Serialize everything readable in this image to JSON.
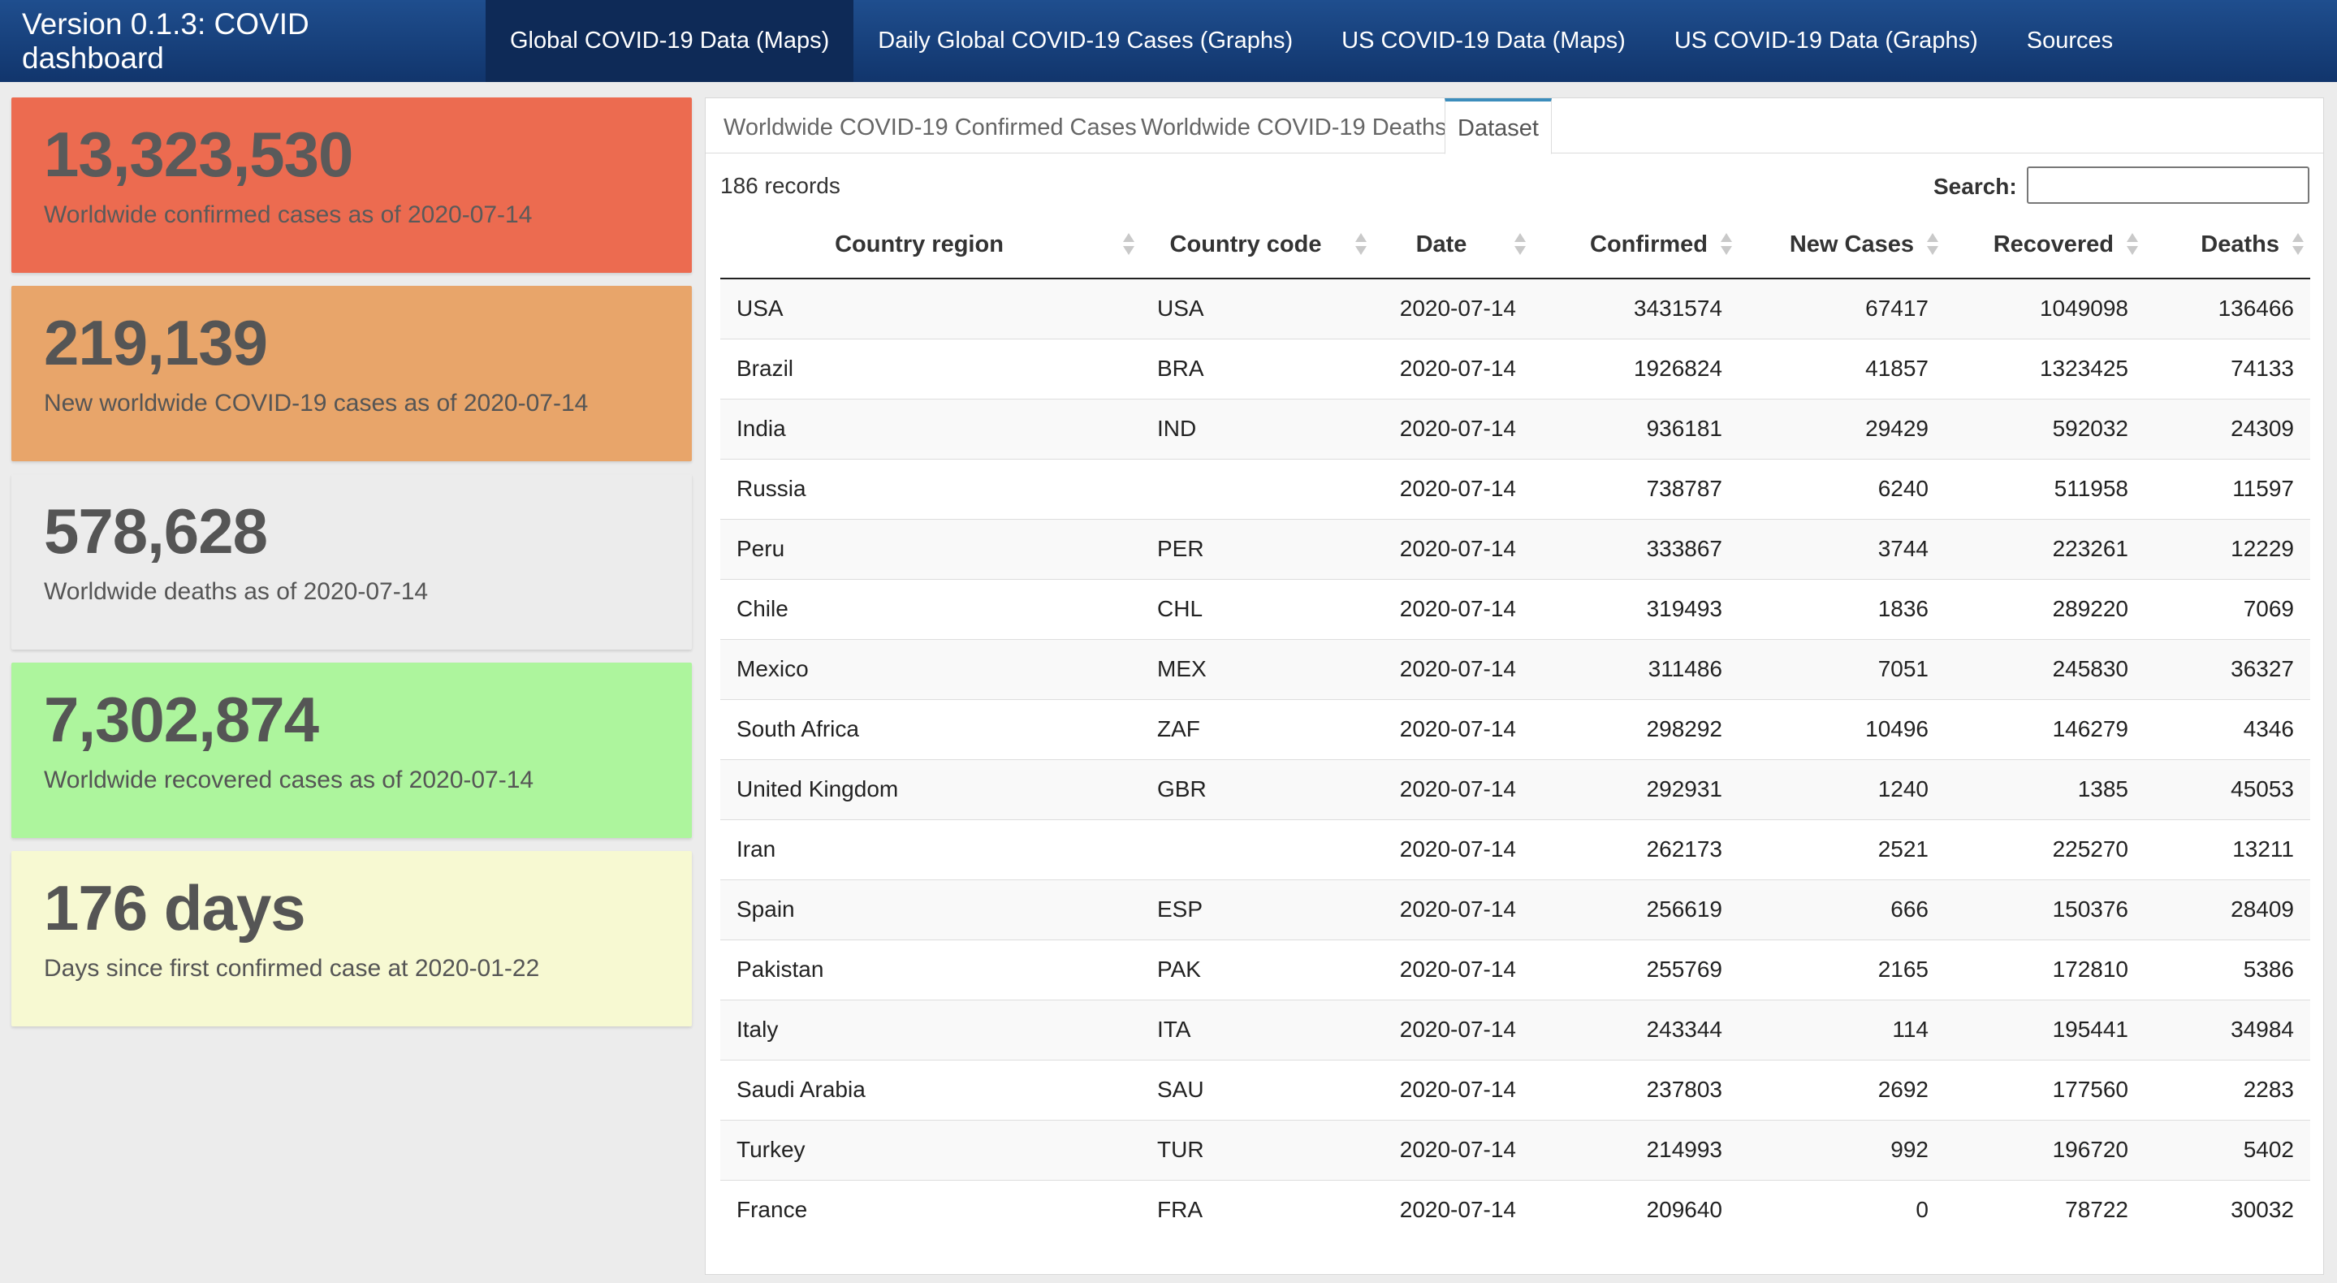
{
  "navbar": {
    "brand": "Version 0.1.3: COVID dashboard",
    "items": [
      {
        "label": "Global COVID-19 Data (Maps)",
        "active": true
      },
      {
        "label": "Daily Global COVID-19 Cases (Graphs)",
        "active": false
      },
      {
        "label": "US COVID-19 Data (Maps)",
        "active": false
      },
      {
        "label": "US COVID-19 Data (Graphs)",
        "active": false
      },
      {
        "label": "Sources",
        "active": false
      }
    ]
  },
  "value_boxes": [
    {
      "value": "13,323,530",
      "description": "Worldwide confirmed cases as of 2020-07-14",
      "color": "#ec6b50"
    },
    {
      "value": "219,139",
      "description": "New worldwide COVID-19 cases as of 2020-07-14",
      "color": "#e8a56a"
    },
    {
      "value": "578,628",
      "description": "Worldwide deaths as of 2020-07-14",
      "color": "#ececec"
    },
    {
      "value": "7,302,874",
      "description": "Worldwide recovered cases as of 2020-07-14",
      "color": "#adf59d"
    },
    {
      "value": "176 days",
      "description": "Days since first confirmed case at 2020-01-22",
      "color": "#f7f9d2"
    }
  ],
  "tabs": [
    {
      "label": "Worldwide COVID-19 Confirmed Cases",
      "active": false
    },
    {
      "label": "Worldwide COVID-19 Deaths",
      "active": false
    },
    {
      "label": "Dataset",
      "active": true
    }
  ],
  "dataset": {
    "records_label": "186 records",
    "search_label": "Search:",
    "search_value": "",
    "columns": [
      "Country region",
      "Country code",
      "Date",
      "Confirmed",
      "New Cases",
      "Recovered",
      "Deaths"
    ],
    "rows": [
      [
        "USA",
        "USA",
        "2020-07-14",
        "3431574",
        "67417",
        "1049098",
        "136466"
      ],
      [
        "Brazil",
        "BRA",
        "2020-07-14",
        "1926824",
        "41857",
        "1323425",
        "74133"
      ],
      [
        "India",
        "IND",
        "2020-07-14",
        "936181",
        "29429",
        "592032",
        "24309"
      ],
      [
        "Russia",
        "",
        "2020-07-14",
        "738787",
        "6240",
        "511958",
        "11597"
      ],
      [
        "Peru",
        "PER",
        "2020-07-14",
        "333867",
        "3744",
        "223261",
        "12229"
      ],
      [
        "Chile",
        "CHL",
        "2020-07-14",
        "319493",
        "1836",
        "289220",
        "7069"
      ],
      [
        "Mexico",
        "MEX",
        "2020-07-14",
        "311486",
        "7051",
        "245830",
        "36327"
      ],
      [
        "South Africa",
        "ZAF",
        "2020-07-14",
        "298292",
        "10496",
        "146279",
        "4346"
      ],
      [
        "United Kingdom",
        "GBR",
        "2020-07-14",
        "292931",
        "1240",
        "1385",
        "45053"
      ],
      [
        "Iran",
        "",
        "2020-07-14",
        "262173",
        "2521",
        "225270",
        "13211"
      ],
      [
        "Spain",
        "ESP",
        "2020-07-14",
        "256619",
        "666",
        "150376",
        "28409"
      ],
      [
        "Pakistan",
        "PAK",
        "2020-07-14",
        "255769",
        "2165",
        "172810",
        "5386"
      ],
      [
        "Italy",
        "ITA",
        "2020-07-14",
        "243344",
        "114",
        "195441",
        "34984"
      ],
      [
        "Saudi Arabia",
        "SAU",
        "2020-07-14",
        "237803",
        "2692",
        "177560",
        "2283"
      ],
      [
        "Turkey",
        "TUR",
        "2020-07-14",
        "214993",
        "992",
        "196720",
        "5402"
      ],
      [
        "France",
        "FRA",
        "2020-07-14",
        "209640",
        "0",
        "78722",
        "30032"
      ]
    ]
  }
}
